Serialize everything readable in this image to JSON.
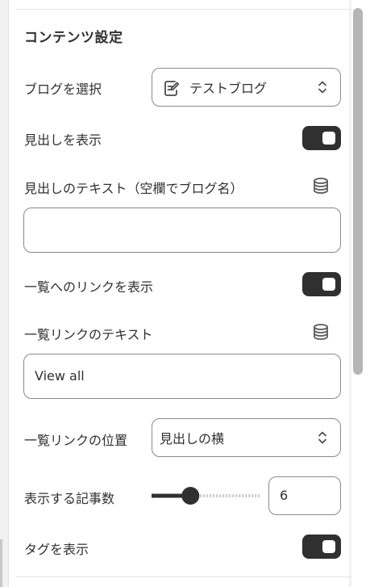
{
  "section": {
    "title": "コンテンツ設定"
  },
  "blog_select": {
    "label": "ブログを選択",
    "value": "テストブログ",
    "icon": "edit-note-icon"
  },
  "show_heading": {
    "label": "見出しを表示",
    "checked": true
  },
  "heading_text": {
    "label": "見出しのテキスト（空欄でブログ名）",
    "value": "",
    "icon": "database-icon"
  },
  "show_list_link": {
    "label": "一覧へのリンクを表示",
    "checked": true
  },
  "list_link_text": {
    "label": "一覧リンクのテキスト",
    "value": "View all",
    "icon": "database-icon"
  },
  "list_link_position": {
    "label": "一覧リンクの位置",
    "value": "見出しの横"
  },
  "article_count": {
    "label": "表示する記事数",
    "value": "6",
    "slider_fraction": 0.33
  },
  "show_tags": {
    "label": "タグを表示",
    "checked": true
  },
  "colors": {
    "toggle_on": "#303030",
    "border": "#8a8a8a",
    "text": "#303030"
  }
}
